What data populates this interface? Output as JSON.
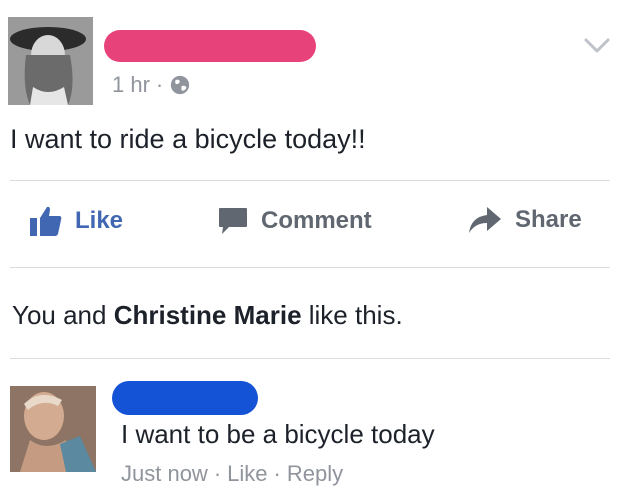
{
  "post": {
    "time": "1 hr",
    "separator": "·",
    "privacy_icon": "globe-icon",
    "text": "I want to ride a bicycle today!!"
  },
  "actions": {
    "like": {
      "label": "Like",
      "icon": "thumbs-up-icon"
    },
    "comment": {
      "label": "Comment",
      "icon": "speech-bubble-icon"
    },
    "share": {
      "label": "Share",
      "icon": "share-arrow-icon"
    }
  },
  "likes_summary": {
    "prefix": "You and ",
    "name": "Christine Marie",
    "suffix": " like this."
  },
  "comment": {
    "text": "I want to be a bicycle today",
    "time": "Just now",
    "like_label": "Like",
    "reply_label": "Reply",
    "dot": "·"
  },
  "colors": {
    "brand_blue": "#4267b2",
    "muted_gray": "#90949c",
    "name_redaction_pink": "#e8427a",
    "name_redaction_blue": "#1553d6"
  }
}
